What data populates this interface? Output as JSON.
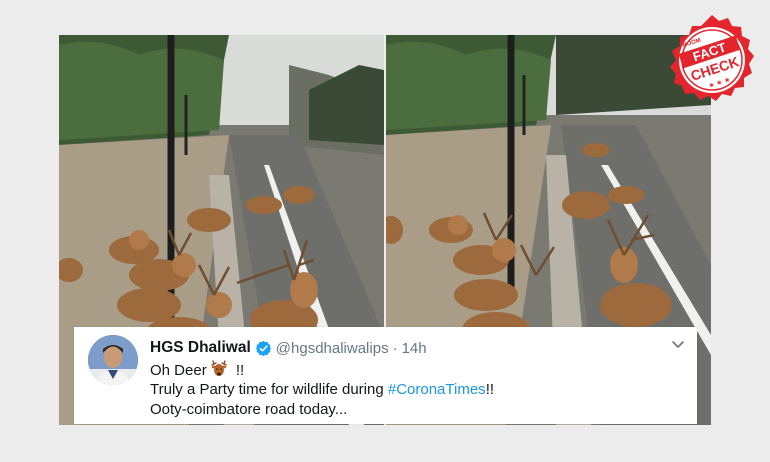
{
  "tweet": {
    "display_name": "HGS Dhaliwal",
    "handle": "@hgsdhaliwalips",
    "separator": "·",
    "time": "14h",
    "line1_text": "Oh Deer",
    "line1_suffix": " !!",
    "line2_prefix": "Truly a Party time for wildlife during ",
    "line2_hashtag": "#CoronaTimes",
    "line2_suffix": "!!",
    "line3": "Ooty-coimbatore road today..."
  },
  "badge": {
    "top_text": "BOOM",
    "word1": "FACT",
    "word2": "CHECK",
    "color": "#e3262e"
  },
  "colors": {
    "verified": "#1da1f2",
    "hashtag": "#1b95e0",
    "muted": "#657786"
  }
}
